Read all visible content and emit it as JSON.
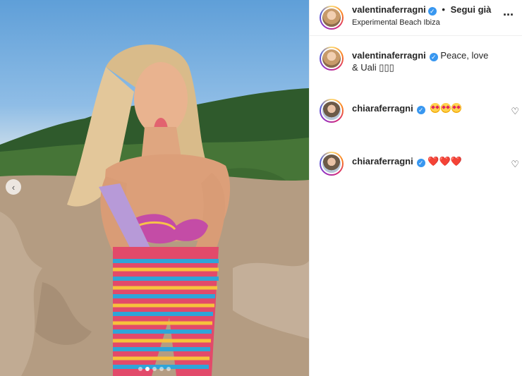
{
  "post": {
    "author": "valentinaferragni",
    "follow_label": "Segui già",
    "bullet": "•",
    "location": "Experimental Beach Ibiza",
    "more_icon": "···",
    "verified_icon": "✓",
    "carousel": {
      "prev_icon": "‹",
      "slides": 5,
      "active_index": 1
    }
  },
  "caption": {
    "user": "valentinaferragni",
    "text": "Peace, love & Uali ▯▯▯"
  },
  "comments": [
    {
      "user": "chiaraferragni",
      "text": "",
      "emoji": [
        "heart-eyes",
        "heart-eyes",
        "heart-eyes"
      ],
      "like_icon": "♡"
    },
    {
      "user": "chiaraferragni",
      "text": "❤️❤️❤️",
      "emoji": [],
      "like_icon": "♡"
    }
  ],
  "colors": {
    "verified": "#3897f0",
    "text": "#262626",
    "divider": "#efefef"
  }
}
